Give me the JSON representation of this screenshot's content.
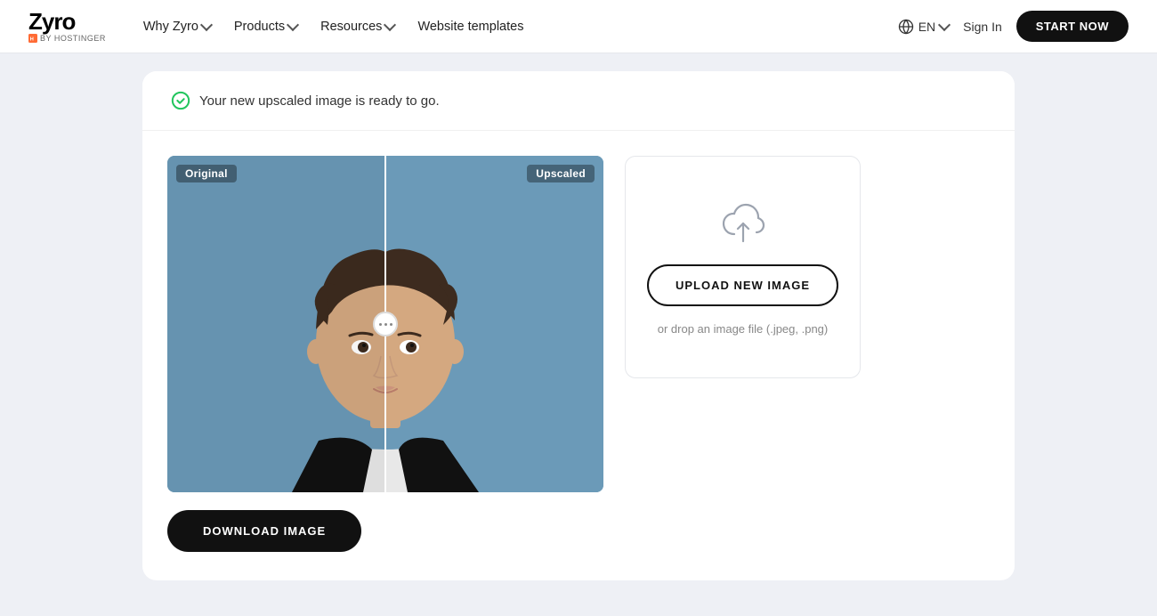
{
  "navbar": {
    "logo_zyro": "Zyro",
    "logo_sub": "BY HOSTINGER",
    "nav_items": [
      {
        "label": "Why Zyro",
        "has_dropdown": true
      },
      {
        "label": "Products",
        "has_dropdown": true
      },
      {
        "label": "Resources",
        "has_dropdown": true
      },
      {
        "label": "Website templates",
        "has_dropdown": false
      }
    ],
    "lang_label": "EN",
    "signin_label": "Sign In",
    "cta_label": "START NOW"
  },
  "success_banner": {
    "message": "Your new upscaled image is ready to go."
  },
  "image_comparison": {
    "original_label": "Original",
    "upscaled_label": "Upscaled"
  },
  "upload_panel": {
    "upload_button_label": "UPLOAD NEW IMAGE",
    "drop_text": "or drop an image file (.jpeg, .png)"
  },
  "download": {
    "button_label": "DOWNLOAD IMAGE"
  }
}
